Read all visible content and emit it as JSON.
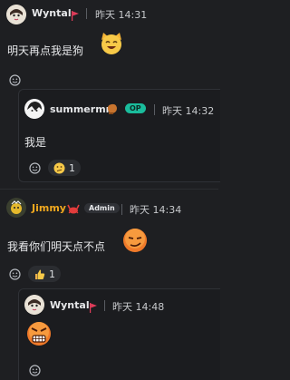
{
  "messages": [
    {
      "author": "Wyntal",
      "time": "昨天 14:31",
      "text": "明天再点我是狗"
    },
    {
      "author": "summermr",
      "badge": "OP",
      "time": "昨天 14:32",
      "text": "我是",
      "reaction_count": "1"
    },
    {
      "author": "Jimmy",
      "badge": "Admin",
      "time": "昨天 14:34",
      "text": "我看你们明天点不点",
      "reaction_count": "1"
    },
    {
      "author": "Wyntal",
      "time": "昨天 14:48"
    }
  ],
  "colors": {
    "background": "#1e1f22",
    "thread_border": "#2f3136",
    "op_badge": "#1abc9c",
    "admin_name": "#f0a81f",
    "flag": "#e23c5a"
  },
  "icons": [
    "flag-icon",
    "boxing-glove-icon",
    "crab-icon",
    "add-reaction-icon",
    "cat-emoji",
    "confused-emoji",
    "smirk-emoji",
    "thumbs-up-emoji",
    "angry-emoji"
  ]
}
